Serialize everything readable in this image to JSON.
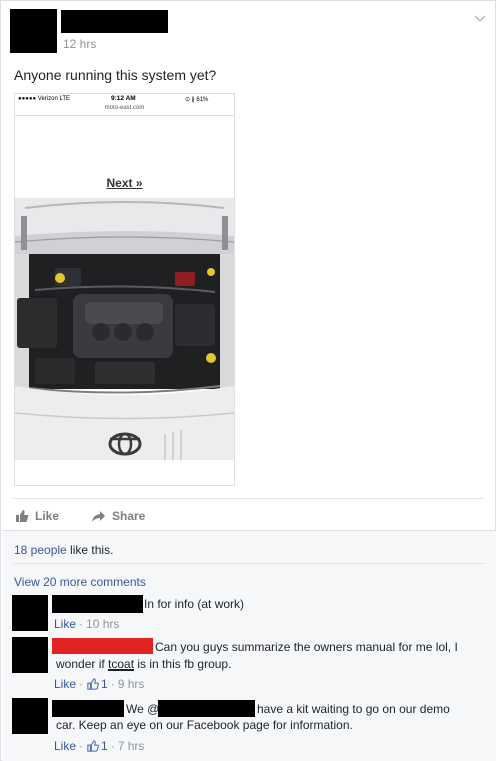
{
  "post": {
    "timestamp": "12 hrs",
    "text": "Anyone running this system yet?"
  },
  "shared_image": {
    "status_carrier": "●●●●● Verizon  LTE",
    "status_time": "9:12 AM",
    "status_battery": "⊙ ∦ 61%",
    "url": "moto-east.com",
    "next_link": "Next »"
  },
  "actions": {
    "like_label": "Like",
    "share_label": "Share"
  },
  "feedback": {
    "likes_count": "18 people",
    "likes_suffix": " like this.",
    "view_more": "View 20 more comments"
  },
  "comments": [
    {
      "text": "In for info (at work)",
      "like_label": "Like",
      "time": "10 hrs"
    },
    {
      "text_line1": "Can you guys summarize the owners manual for me lol, I",
      "text_line2_a": "wonder if ",
      "text_line2_mark": "tcoat",
      "text_line2_b": " is in this fb group.",
      "like_label": "Like",
      "like_count": "1",
      "time": "9 hrs"
    },
    {
      "text_a": "We @",
      "text_b": "have a kit waiting to go on our demo",
      "text_line2": "car. Keep an eye on our Facebook page for information.",
      "like_label": "Like",
      "like_count": "1",
      "time": "7 hrs"
    }
  ],
  "colors": {
    "link": "#365899",
    "meta": "#90949c",
    "redaction": "#000000",
    "redaction_red": "#e02424"
  }
}
